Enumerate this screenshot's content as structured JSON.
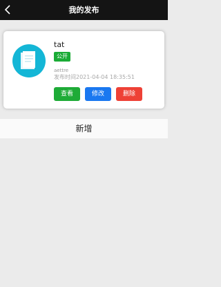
{
  "header": {
    "title": "我的发布",
    "back_icon": "chevron-left-icon"
  },
  "card": {
    "thumbnail_icon": "document-icon",
    "thumbnail_color": "#14b6d6",
    "title": "tat",
    "badge": "公开",
    "author": "aettre",
    "publish_time": "发布时间2021-04-04 18:35:51",
    "buttons": {
      "view": "查看",
      "edit": "修改",
      "delete": "删除"
    }
  },
  "add_label": "新增",
  "colors": {
    "header_bg": "#141414",
    "badge": "#1aab36",
    "view": "#1eab37",
    "edit": "#1a78f0",
    "delete": "#ee4136"
  }
}
